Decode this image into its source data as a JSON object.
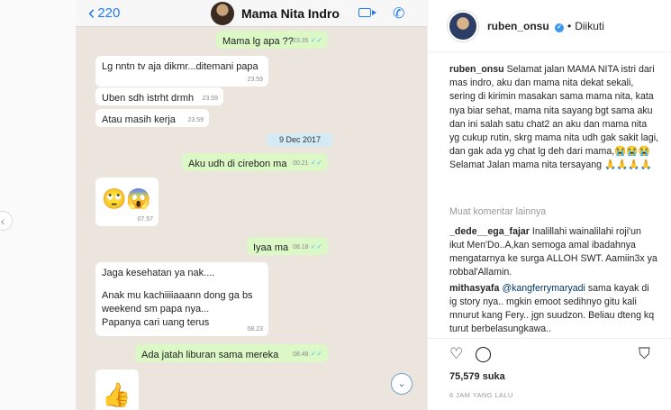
{
  "nav": {
    "prev_icon": "chevron-left-icon",
    "next_icon": "chevron-right-icon"
  },
  "chat": {
    "back_count": "220",
    "contact_name": "Mama Nita Indro",
    "date_separator": "9 Dec 2017",
    "messages": [
      {
        "text": "Mama lg apa ??",
        "time": "23.35",
        "dir": "out"
      },
      {
        "text": "Lg nntn tv aja dikmr...ditemani papa",
        "time": "23.59",
        "dir": "in"
      },
      {
        "text": "Uben sdh istrht drmh",
        "time": "23.59",
        "dir": "in"
      },
      {
        "text": "Atau masih kerja",
        "time": "23.59",
        "dir": "in"
      },
      {
        "text": "Aku udh di cirebon ma",
        "time": "00.21",
        "dir": "out"
      },
      {
        "text": "🙄😱",
        "time": "07.57",
        "dir": "in"
      },
      {
        "text": "Iyaa ma",
        "time": "08.18",
        "dir": "out"
      },
      {
        "text": "Jaga kesehatan ya nak....",
        "time": "",
        "dir": "in"
      },
      {
        "text": "Anak mu kachiiiiaaann dong ga bs weekend sm papa nya...",
        "time": "",
        "dir": "in"
      },
      {
        "text": "Papanya cari uang terus",
        "time": "08.23",
        "dir": "in"
      },
      {
        "text": "Ada jatah liburan sama mereka",
        "time": "08.48",
        "dir": "out"
      },
      {
        "text": "👍",
        "time": "",
        "dir": "in"
      }
    ]
  },
  "post": {
    "username": "ruben_onsu",
    "follow_status": "Diikuti",
    "caption": "Selamat jalan MAMA NITA istri dari mas indro, aku dan mama nita dekat sekali, sering di kirimin masakan sama mama nita, kata nya biar sehat, mama nita sayang bgt sama aku dan ini salah satu chat2 an aku dan mama nita yg cukup rutin, skrg mama nita udh gak sakit lagi, dan gak ada yg chat lg deh dari mama,😭😭😭 Selamat Jalan mama nita tersayang 🙏🙏🙏🙏",
    "more_comments": "Muat komentar lainnya",
    "comments": [
      {
        "user": "_dede__ega_fajar",
        "text": "Inalillahi wainalilahi roji'un ikut Men'Do..A,kan semoga amal ibadahnya mengatarnya ke surga ALLOH SWT. Aamiin3x ya robbal'Allamin."
      },
      {
        "user": "mithasyafa",
        "mention": "@kangferrymaryadi",
        "text": "sama kayak di ig story nya.. mgkin emoot sedihnyo gitu kali mnurut kang Fery.. jgn suudzon. Beliau dteng kq turut berbelasungkawa.."
      }
    ],
    "likes": "75,579 suka",
    "time_ago": "6 JAM YANG LALU"
  },
  "colors": {
    "wa_out": "#dcf8c6",
    "wa_in": "#ffffff",
    "wa_bg": "#ece5dd",
    "ios_blue": "#1f7bf2",
    "ig_link": "#003569"
  }
}
